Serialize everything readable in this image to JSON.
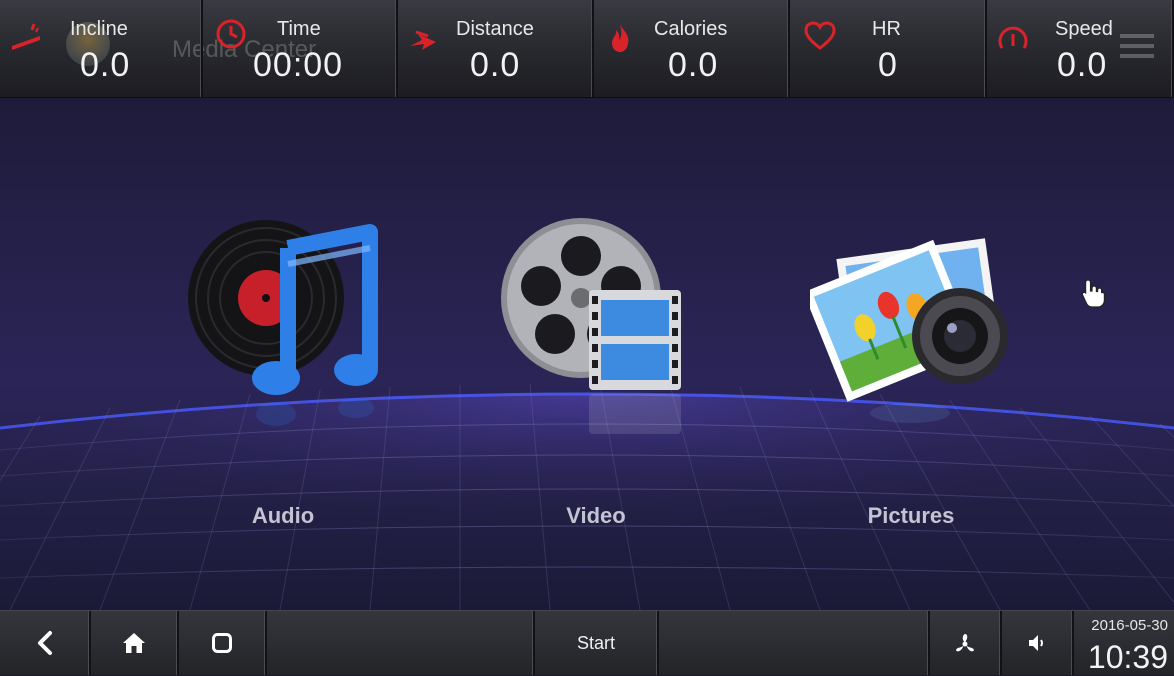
{
  "stats": [
    {
      "label": "Incline",
      "value": "0.0",
      "icon": "incline-icon"
    },
    {
      "label": "Time",
      "value": "00:00",
      "icon": "clock-icon"
    },
    {
      "label": "Distance",
      "value": "0.0",
      "icon": "distance-icon"
    },
    {
      "label": "Calories",
      "value": "0.0",
      "icon": "flame-icon"
    },
    {
      "label": "HR",
      "value": "0",
      "icon": "heart-icon"
    },
    {
      "label": "Speed",
      "value": "0.0",
      "icon": "speedometer-icon"
    }
  ],
  "background_title": "Media Center",
  "media": {
    "audio_label": "Audio",
    "video_label": "Video",
    "pictures_label": "Pictures"
  },
  "navbar": {
    "start_label": "Start",
    "date": "2016-05-30",
    "time": "10:39"
  },
  "colors": {
    "accent_red": "#d9232a",
    "label_grey": "#c3c3d2",
    "bar_dark": "#232428"
  }
}
